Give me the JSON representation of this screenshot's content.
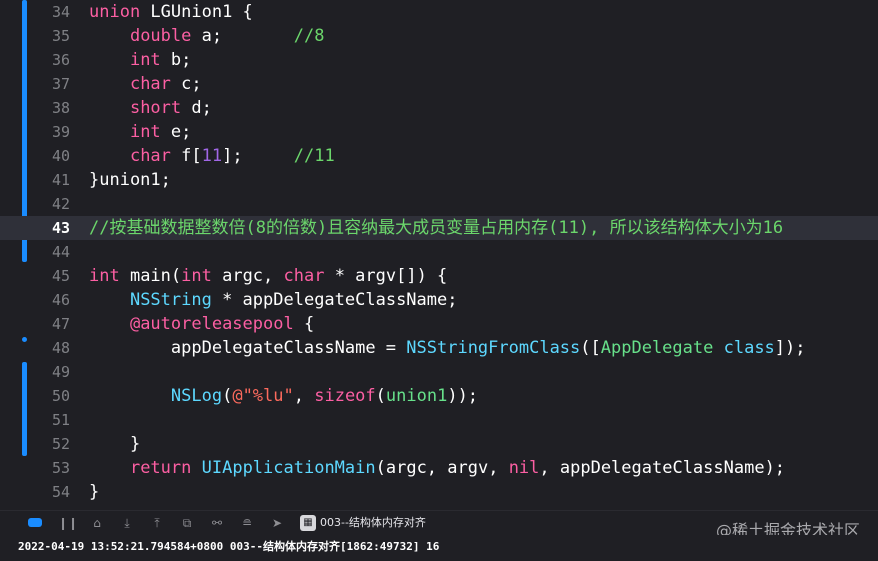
{
  "editor": {
    "lines": [
      {
        "num": "34",
        "tokens": [
          [
            "kw",
            "union"
          ],
          [
            "plain",
            " LGUnion1 {"
          ]
        ]
      },
      {
        "num": "35",
        "tokens": [
          [
            "plain",
            "    "
          ],
          [
            "type",
            "double"
          ],
          [
            "plain",
            " a;       "
          ],
          [
            "comment",
            "//8"
          ]
        ]
      },
      {
        "num": "36",
        "tokens": [
          [
            "plain",
            "    "
          ],
          [
            "type",
            "int"
          ],
          [
            "plain",
            " b;"
          ]
        ]
      },
      {
        "num": "37",
        "tokens": [
          [
            "plain",
            "    "
          ],
          [
            "type",
            "char"
          ],
          [
            "plain",
            " c;"
          ]
        ]
      },
      {
        "num": "38",
        "tokens": [
          [
            "plain",
            "    "
          ],
          [
            "type",
            "short"
          ],
          [
            "plain",
            " d;"
          ]
        ]
      },
      {
        "num": "39",
        "tokens": [
          [
            "plain",
            "    "
          ],
          [
            "type",
            "int"
          ],
          [
            "plain",
            " e;"
          ]
        ]
      },
      {
        "num": "40",
        "tokens": [
          [
            "plain",
            "    "
          ],
          [
            "type",
            "char"
          ],
          [
            "plain",
            " f["
          ],
          [
            "num-purple",
            "11"
          ],
          [
            "plain",
            "];     "
          ],
          [
            "comment",
            "//11"
          ]
        ]
      },
      {
        "num": "41",
        "tokens": [
          [
            "plain",
            "}union1;"
          ]
        ]
      },
      {
        "num": "42",
        "tokens": []
      },
      {
        "num": "43",
        "highlight": true,
        "tokens": [
          [
            "comment",
            "//按基础数据整数倍(8的倍数)且容纳最大成员变量占用内存(11), 所以该结构体大小为16"
          ]
        ]
      },
      {
        "num": "44",
        "tokens": []
      },
      {
        "num": "45",
        "tokens": [
          [
            "type",
            "int"
          ],
          [
            "plain",
            " main("
          ],
          [
            "type",
            "int"
          ],
          [
            "plain",
            " argc, "
          ],
          [
            "type",
            "char"
          ],
          [
            "plain",
            " * argv[]) {"
          ]
        ]
      },
      {
        "num": "46",
        "tokens": [
          [
            "plain",
            "    "
          ],
          [
            "class-blue",
            "NSString"
          ],
          [
            "plain",
            " * appDelegateClassName;"
          ]
        ]
      },
      {
        "num": "47",
        "tokens": [
          [
            "plain",
            "    "
          ],
          [
            "kw",
            "@autoreleasepool"
          ],
          [
            "plain",
            " {"
          ]
        ]
      },
      {
        "num": "48",
        "tokens": [
          [
            "plain",
            "        appDelegateClassName = "
          ],
          [
            "class-blue",
            "NSStringFromClass"
          ],
          [
            "plain",
            "(["
          ],
          [
            "ident-green",
            "AppDelegate"
          ],
          [
            "plain",
            " "
          ],
          [
            "class-blue",
            "class"
          ],
          [
            "plain",
            "]);"
          ]
        ]
      },
      {
        "num": "49",
        "tokens": []
      },
      {
        "num": "50",
        "tokens": [
          [
            "plain",
            "        "
          ],
          [
            "class-blue",
            "NSLog"
          ],
          [
            "plain",
            "("
          ],
          [
            "str",
            "@\"%lu\""
          ],
          [
            "plain",
            ", "
          ],
          [
            "sizeof",
            "sizeof"
          ],
          [
            "plain",
            "("
          ],
          [
            "ident-green",
            "union1"
          ],
          [
            "plain",
            "));"
          ]
        ]
      },
      {
        "num": "51",
        "tokens": []
      },
      {
        "num": "52",
        "tokens": [
          [
            "plain",
            "    }"
          ]
        ]
      },
      {
        "num": "53",
        "tokens": [
          [
            "plain",
            "    "
          ],
          [
            "kw",
            "return"
          ],
          [
            "plain",
            " "
          ],
          [
            "class-blue",
            "UIApplicationMain"
          ],
          [
            "plain",
            "(argc, argv, "
          ],
          [
            "kw",
            "nil"
          ],
          [
            "plain",
            ", appDelegateClassName);"
          ]
        ]
      },
      {
        "num": "54",
        "tokens": [
          [
            "plain",
            "}"
          ]
        ]
      }
    ]
  },
  "debug_bar": {
    "buttons": [
      {
        "name": "toggle-console-button",
        "icon": "console-toggle-icon",
        "glyph": ""
      },
      {
        "name": "pause-button",
        "icon": "pause-icon",
        "glyph": "❙❙"
      },
      {
        "name": "step-over-button",
        "icon": "step-over-icon",
        "glyph": "⌂"
      },
      {
        "name": "step-into-button",
        "icon": "step-into-icon",
        "glyph": "⤓"
      },
      {
        "name": "step-out-button",
        "icon": "step-out-icon",
        "glyph": "⤒"
      },
      {
        "name": "view-hierarchy-button",
        "icon": "view-hierarchy-icon",
        "glyph": "⧉"
      },
      {
        "name": "memory-graph-button",
        "icon": "memory-graph-icon",
        "glyph": "⚯"
      },
      {
        "name": "environment-overrides-button",
        "icon": "environment-overrides-icon",
        "glyph": "≘"
      },
      {
        "name": "simulate-location-button",
        "icon": "location-icon",
        "glyph": "➤"
      }
    ],
    "target_label": "003--结构体内存对齐"
  },
  "console": {
    "log_line": "2022-04-19 13:52:21.794584+0800 003--结构体内存对齐[1862:49732] 16"
  },
  "watermark": "@稀土掘金技术社区",
  "colors": {
    "background": "#1f1f24",
    "keyword": "#fc5fa3",
    "comment": "#6bd66b",
    "class": "#5dd8ff",
    "accent": "#1a8cff"
  }
}
